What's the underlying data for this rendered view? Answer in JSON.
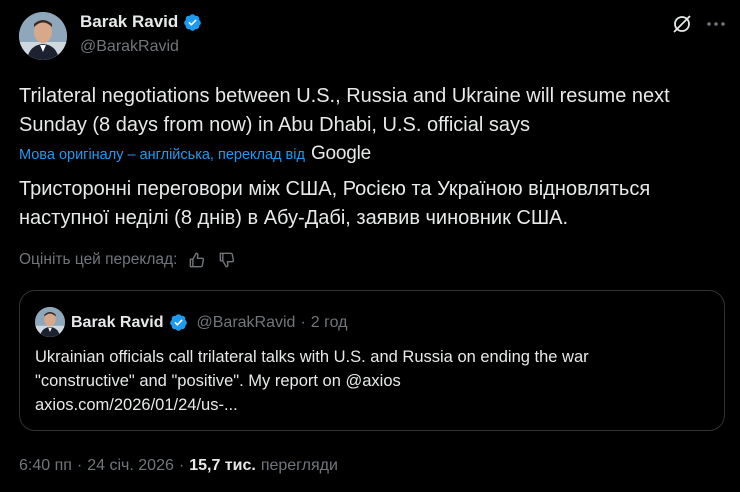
{
  "author": {
    "name": "Barak Ravid",
    "handle": "@BarakRavid"
  },
  "tweet": {
    "text_line1": "Trilateral negotiations between U.S., Russia and Ukraine will resume next",
    "text_line2": "Sunday (8 days from now) in Abu Dhabi, U.S. official says"
  },
  "translation": {
    "note": "Мова оригіналу – англійська, переклад від",
    "provider": "Google",
    "text_line1": "Тристоронні переговори між США, Росією та Україною відновляться",
    "text_line2": "наступної неділі (8 днів) в Абу-Дабі, заявив чиновник США.",
    "rate_label": "Оцініть цей переклад:"
  },
  "quote": {
    "name": "Barak Ravid",
    "handle": "@BarakRavid",
    "separator": "·",
    "time": "2 год",
    "text_line1": "Ukrainian officials call trilateral talks with U.S. and Russia on ending the war",
    "text_line2": "\"constructive\" and \"positive\". My report on @axios",
    "text_line3": "axios.com/2026/01/24/us-..."
  },
  "footer": {
    "time": "6:40 пп",
    "separator1": "·",
    "date": "24 січ. 2026",
    "separator2": "·",
    "views": "15,7 тис.",
    "views_label": "перегляди"
  },
  "colors": {
    "background": "#000000",
    "text": "#e7e9ea",
    "muted": "#71767b",
    "accent": "#1d9bf0",
    "border": "#2f3336"
  },
  "icons": [
    "verified-badge-icon",
    "grok-icon",
    "more-icon",
    "thumbs-up-icon",
    "thumbs-down-icon"
  ]
}
